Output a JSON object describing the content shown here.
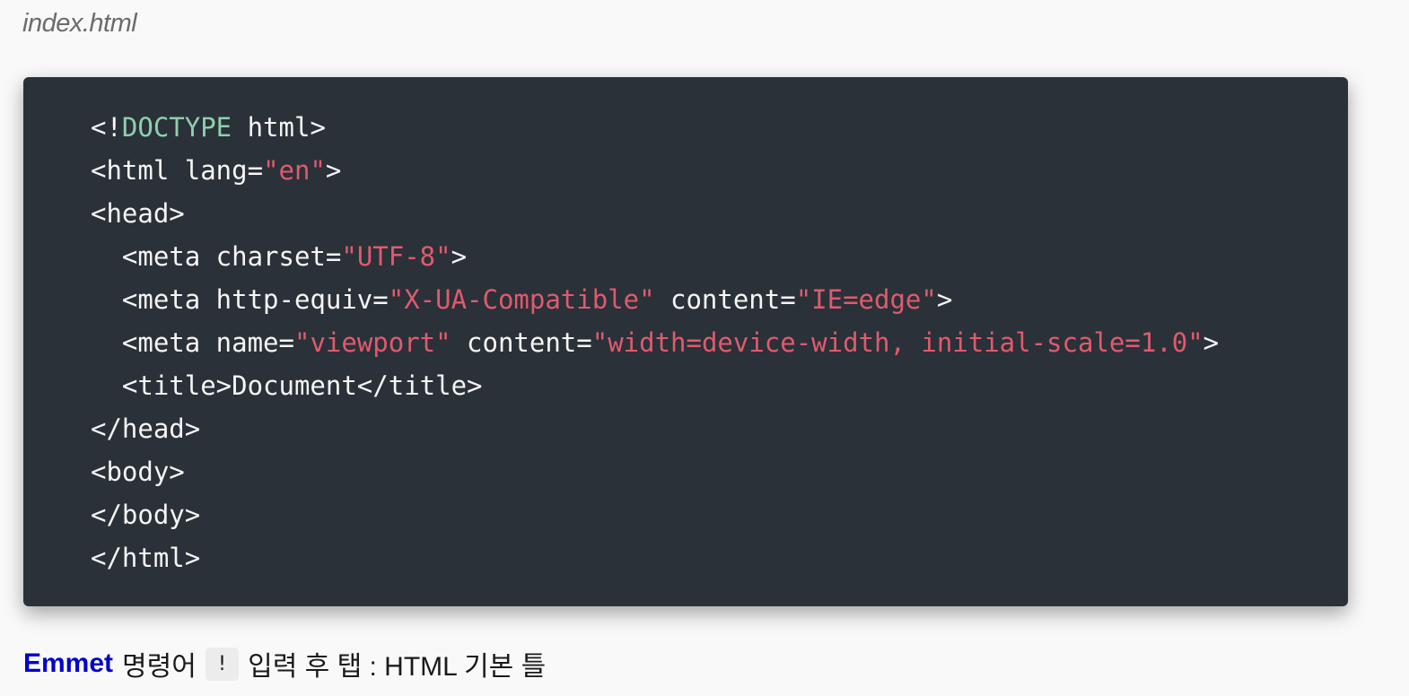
{
  "filename": "index.html",
  "code_lines": [
    [
      {
        "t": "plain",
        "v": "<!"
      },
      {
        "t": "doctype",
        "v": "DOCTYPE"
      },
      {
        "t": "plain",
        "v": " html>"
      }
    ],
    [
      {
        "t": "plain",
        "v": "<html lang="
      },
      {
        "t": "string",
        "v": "\"en\""
      },
      {
        "t": "plain",
        "v": ">"
      }
    ],
    [
      {
        "t": "plain",
        "v": "<head>"
      }
    ],
    [
      {
        "t": "plain",
        "v": "  <meta charset="
      },
      {
        "t": "string",
        "v": "\"UTF-8\""
      },
      {
        "t": "plain",
        "v": ">"
      }
    ],
    [
      {
        "t": "plain",
        "v": "  <meta http-equiv="
      },
      {
        "t": "string",
        "v": "\"X-UA-Compatible\""
      },
      {
        "t": "plain",
        "v": " content="
      },
      {
        "t": "string",
        "v": "\"IE=edge\""
      },
      {
        "t": "plain",
        "v": ">"
      }
    ],
    [
      {
        "t": "plain",
        "v": "  <meta name="
      },
      {
        "t": "string",
        "v": "\"viewport\""
      },
      {
        "t": "plain",
        "v": " content="
      },
      {
        "t": "string",
        "v": "\"width=device-width, initial-scale=1.0\""
      },
      {
        "t": "plain",
        "v": ">"
      }
    ],
    [
      {
        "t": "plain",
        "v": "  <title>Document</title>"
      }
    ],
    [
      {
        "t": "plain",
        "v": "</head>"
      }
    ],
    [
      {
        "t": "plain",
        "v": "<body>"
      }
    ],
    [
      {
        "t": "plain",
        "v": "</body>"
      }
    ],
    [
      {
        "t": "plain",
        "v": "</html>"
      }
    ]
  ],
  "caption": {
    "link_text": "Emmet",
    "text_before_key": "명령어",
    "key": "!",
    "text_after_key": "입력 후 탭 : HTML 기본 틀"
  },
  "colors": {
    "code_background": "#2a3138",
    "code_plain": "#f5f5f5",
    "code_doctype": "#8fcfae",
    "code_string": "#e05a6e",
    "link": "#0000cc"
  }
}
